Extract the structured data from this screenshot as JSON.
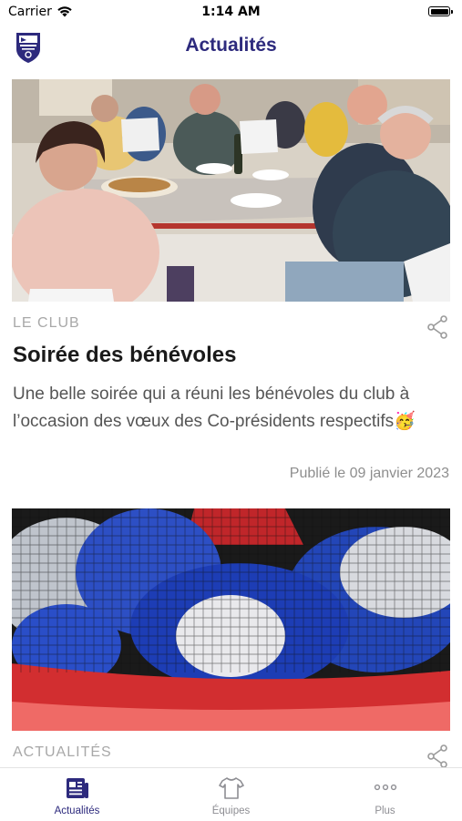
{
  "status_bar": {
    "carrier": "Carrier",
    "time": "1:14 AM"
  },
  "header": {
    "title": "Actualités",
    "brand_color": "#2d2a7d"
  },
  "feed": {
    "items": [
      {
        "category": "LE CLUB",
        "title": "Soirée des bénévoles",
        "excerpt": "Une belle soirée qui a réuni les bénévoles du club à l’occasion des vœux des Co-présidents respectifs🥳",
        "date": "Publié le 09 janvier 2023",
        "photo": "volunteers-dinner-photo",
        "share_icon": "share-icon"
      },
      {
        "category": "ACTUALITÉS",
        "photo": "rugby-balls-photo",
        "share_icon": "share-icon"
      }
    ]
  },
  "tab_bar": {
    "tabs": [
      {
        "label": "Actualités",
        "icon": "newspaper-icon",
        "active": true
      },
      {
        "label": "Équipes",
        "icon": "jersey-icon",
        "active": false
      },
      {
        "label": "Plus",
        "icon": "more-dots-icon",
        "active": false
      }
    ]
  }
}
